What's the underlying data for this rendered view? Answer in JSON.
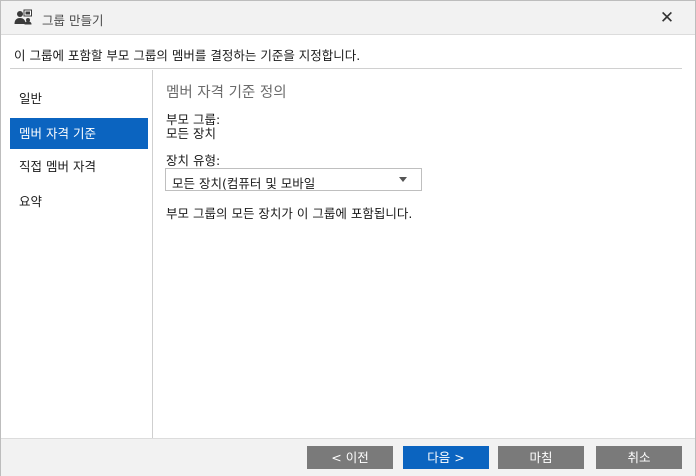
{
  "window": {
    "title": "그룹 만들기",
    "close_label": "✕"
  },
  "instruction": "이 그룹에 포함할 부모 그룹의 멤버를 결정하는 기준을 지정합니다.",
  "sidebar": {
    "items": [
      {
        "label": "일반",
        "active": false
      },
      {
        "label": "멤버 자격 기준",
        "active": true
      },
      {
        "label": "직접 멤버 자격",
        "active": false
      },
      {
        "label": "요약",
        "active": false
      }
    ]
  },
  "main": {
    "section_title": "멤버 자격 기준 정의",
    "parent_group_label": "부모 그룹:",
    "parent_group_value": "모든 장치",
    "device_type_label": "장치 유형:",
    "device_type_selected": "모든 장치(컴퓨터 및 모바일",
    "description": "부모 그룹의 모든 장치가 이 그룹에 포함됩니다."
  },
  "footer": {
    "prev_label": "< 이전",
    "next_label": "다음 >",
    "finish_label": "마침",
    "cancel_label": "취소"
  },
  "colors": {
    "accent": "#0b64c0",
    "button_gray": "#7a7a7a",
    "titlebar_bg": "#f2f2f2"
  }
}
